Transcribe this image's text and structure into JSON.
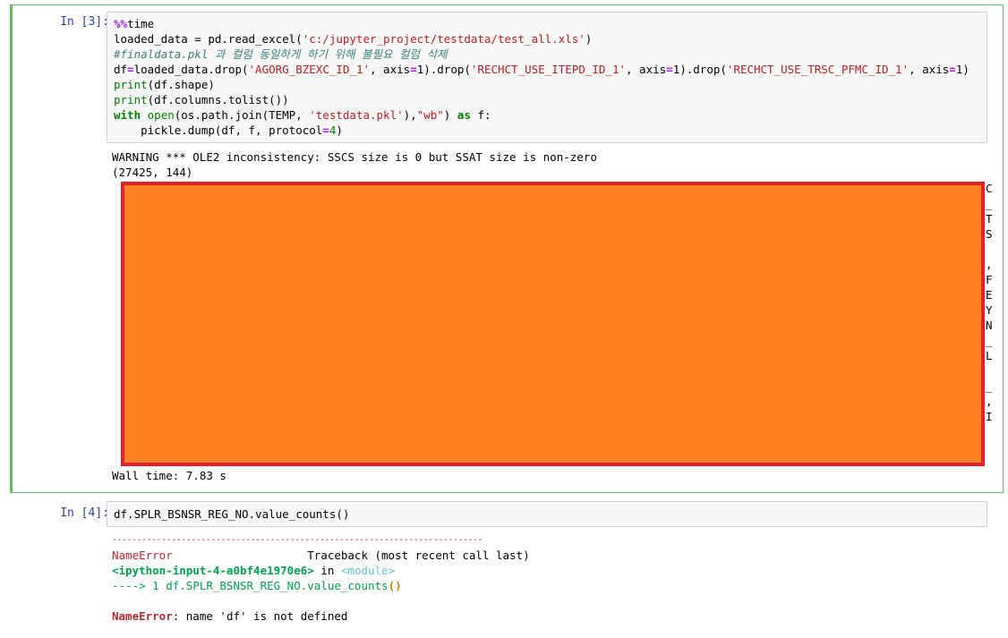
{
  "cells": [
    {
      "prompt": "In [3]:",
      "code": {
        "line1_magic": "%%",
        "line1_rest": "time",
        "line2": "loaded_data = pd.read_excel(",
        "line2_str": "'c:/jupyter_project/testdata/test_all.xls'",
        "line2_end": ")",
        "line3_comment": "#finaldata.pkl 과 컬럼 동일하게 하기 위해 불필요 컬럼 삭제",
        "line4_a": "df",
        "line4_b": "loaded_data.drop(",
        "line4_s1": "'AGORG_BZEXC_ID_1'",
        "line4_c": ", axis",
        "line4_d": "1).drop(",
        "line4_s2": "'RECHCT_USE_ITEPD_ID_1'",
        "line4_e": ", axis",
        "line4_f": "1).drop(",
        "line4_s3": "'RECHCT_USE_TRSC_PFMC_ID_1'",
        "line4_g": ", axis",
        "line4_h": "1)",
        "line5_fn": "print",
        "line5_rest": "(df.shape)",
        "line6_fn": "print",
        "line6_rest": "(df.columns.tolist())",
        "line7_kw": "with",
        "line7_fn": "open",
        "line7_b": "(os.path.join(TEMP, ",
        "line7_s1": "'testdata.pkl'",
        "line7_c": "),",
        "line7_s2": "\"wb\"",
        "line7_d": ") ",
        "line7_as": "as",
        "line7_e": " f:",
        "line8_a": "    pickle.dump(df, f, protocol",
        "line8_num": "4",
        "line8_b": ")"
      },
      "output": {
        "warning": "WARNING *** OLE2 inconsistency: SSCS size is 0 but SSAT size is non-zero",
        "shape": "(27425, 144)",
        "side_chars": [
          "C",
          "_",
          "T",
          "S",
          "",
          ",",
          "F",
          "E",
          "Y",
          "N",
          "_",
          "L",
          "",
          "_",
          ",",
          "I",
          ""
        ],
        "wall_time": "Wall time: 7.83 s"
      }
    },
    {
      "prompt": "In [4]:",
      "code": "df.SPLR_BSNSR_REG_NO.value_counts()",
      "output": {
        "rule": "---------------------------------------------------------------------------",
        "error_name": "NameError",
        "traceback_label": "Traceback (most recent call last)",
        "input_ref": "<ipython-input-4-a0bf4e1970e6>",
        "in_word": " in ",
        "module": "<module>",
        "arrow": "----> 1 df.SPLR_BSNSR_REG_NO.value_counts",
        "arrow_parens": "()",
        "final_error_name": "NameError",
        "final_msg": ": name 'df' is not defined"
      }
    }
  ],
  "colors": {
    "selected_cell_border": "#66bb6a",
    "redaction_fill": "#ff8124",
    "redaction_border": "#e5202a"
  }
}
